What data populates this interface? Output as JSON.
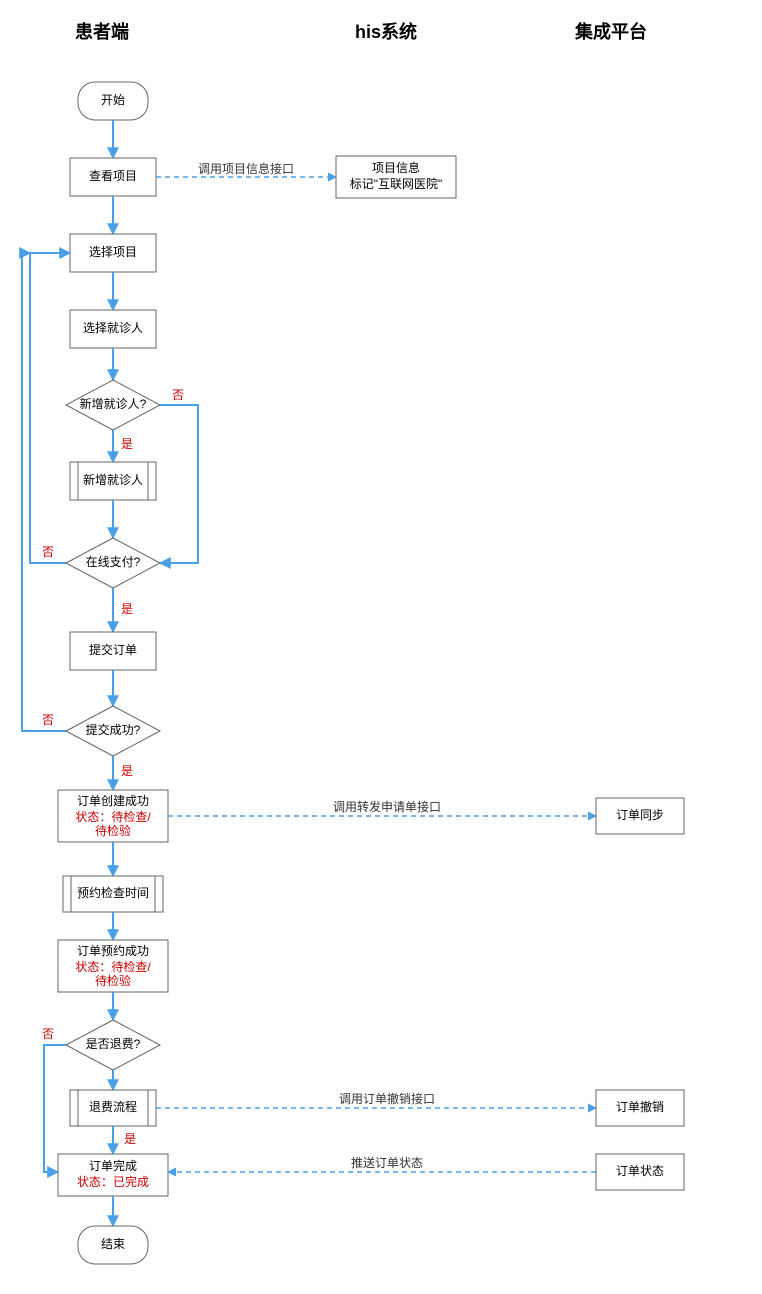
{
  "lanes": {
    "patient": "患者端",
    "his": "his系统",
    "platform": "集成平台"
  },
  "nodes": {
    "start": "开始",
    "view_project": "查看项目",
    "select_project": "选择项目",
    "select_patient": "选择就诊人",
    "add_patient_q": "新增就诊人?",
    "add_patient": "新增就诊人",
    "online_pay_q": "在线支付?",
    "submit_order": "提交订单",
    "submit_ok_q": "提交成功?",
    "order_created_l1": "订单创建成功",
    "order_created_l2": "状态：待检查/",
    "order_created_l3": "待检验",
    "reserve_time": "预约检查时间",
    "order_reserved_l1": "订单预约成功",
    "order_reserved_l2": "状态：待检查/",
    "order_reserved_l3": "待检验",
    "refund_q": "是否退费?",
    "refund_flow": "退费流程",
    "order_done_l1": "订单完成",
    "order_done_l2": "状态：已完成",
    "end": "结束",
    "project_info_l1": "项目信息",
    "project_info_l2": "标记\"互联网医院\"",
    "order_sync": "订单同步",
    "order_cancel": "订单撤销",
    "order_status": "订单状态"
  },
  "edges": {
    "yes": "是",
    "no": "否",
    "call_project_info": "调用项目信息接口",
    "call_forward_request": "调用转发申请单接口",
    "call_order_cancel": "调用订单撤销接口",
    "push_order_status": "推送订单状态"
  },
  "colors": {
    "line": "#4aa0e8",
    "red": "#c00"
  }
}
